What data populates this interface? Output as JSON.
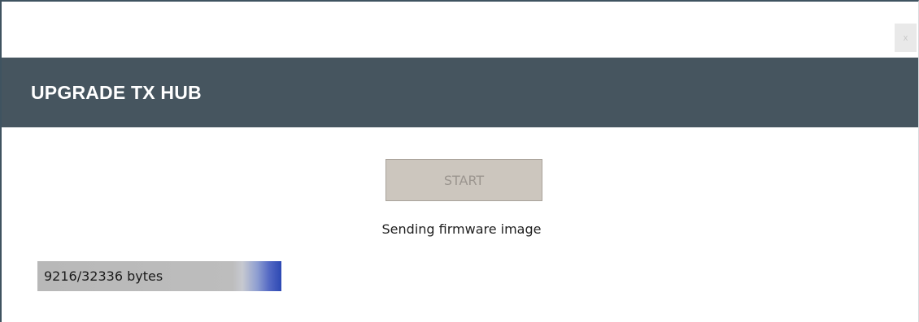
{
  "window": {
    "close_label": "x"
  },
  "header": {
    "title": "UPGRADE TX HUB"
  },
  "actions": {
    "start_label": "START",
    "start_enabled": false
  },
  "status": {
    "message": "Sending firmware image"
  },
  "progress": {
    "label": "9216/32336 bytes",
    "bytes_sent": 9216,
    "bytes_total": 32336,
    "bar_fill_fraction": 1.0
  },
  "colors": {
    "header_background": "#46555f",
    "header_text": "#ffffff",
    "button_background": "#ccc6be",
    "button_text": "#9b958f",
    "progress_accent": "#2c48b3"
  },
  "icons": {
    "close": "close-icon"
  }
}
